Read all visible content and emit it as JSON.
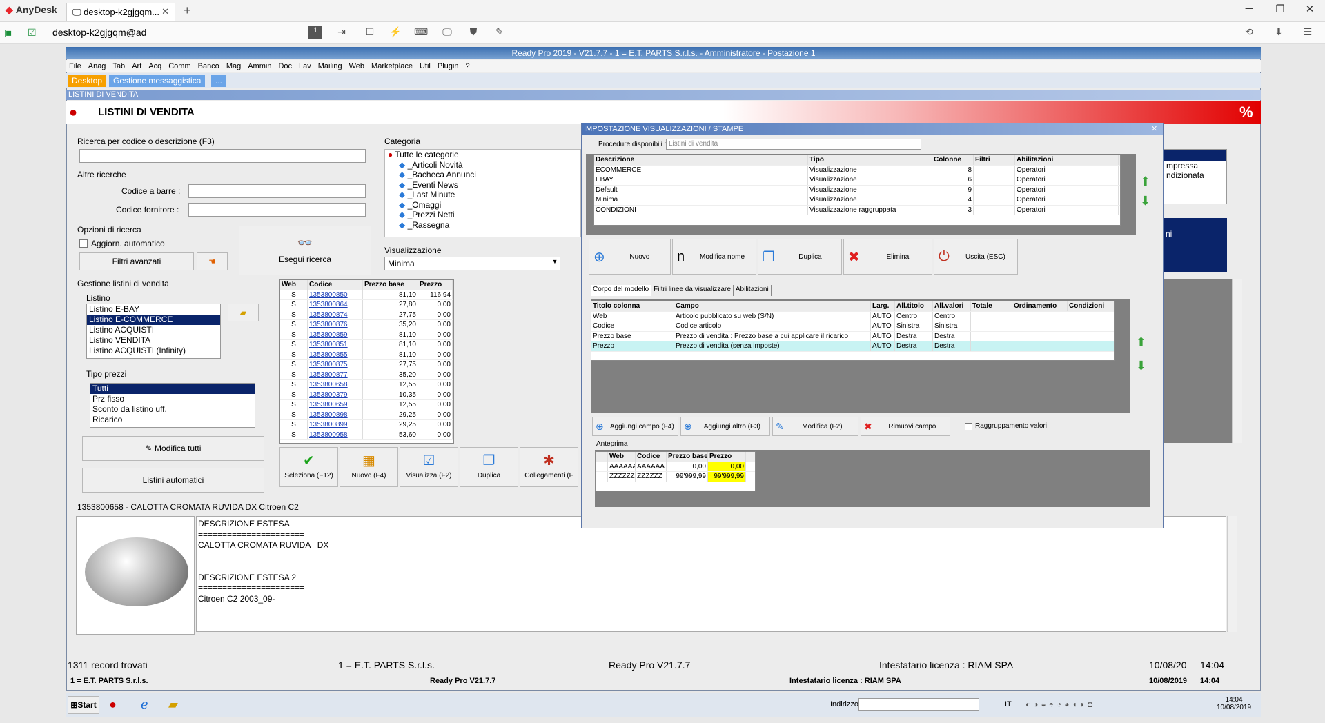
{
  "anydesk": {
    "app": "AnyDesk",
    "tab": "desktop-k2gjgqm...",
    "address": "desktop-k2gjgqm@ad"
  },
  "app": {
    "title": "Ready Pro 2019 - V21.7.7 - 1 = E.T. PARTS S.r.l.s. - Amministratore - Postazione 1",
    "menu": [
      "File",
      "Anag",
      "Tab",
      "Art",
      "Acq",
      "Comm",
      "Banco",
      "Mag",
      "Ammin",
      "Doc",
      "Lav",
      "Mailing",
      "Web",
      "Marketplace",
      "Util",
      "Plugin",
      "?"
    ],
    "tabs": [
      "Desktop",
      "Gestione messaggistica",
      "..."
    ],
    "subtitle": "LISTINI DI VENDITA",
    "header": "LISTINI DI VENDITA"
  },
  "search": {
    "label": "Ricerca per codice o descrizione (F3)",
    "other": "Altre ricerche",
    "barcode": "Codice a barre :",
    "supplier": "Codice fornitore :",
    "options": "Opzioni di ricerca",
    "auto": "Aggiorn. automatico",
    "advanced": "Filtri avanzati",
    "run": "Esegui ricerca"
  },
  "category": {
    "label": "Categoria",
    "items": [
      "Tutte le categorie",
      "_Articoli Novità",
      "_Bacheca Annunci",
      "_Eventi News",
      "_Last Minute",
      "_Omaggi",
      "_Prezzi Netti",
      "_Rassegna"
    ]
  },
  "view": {
    "label": "Visualizzazione",
    "value": "Minima"
  },
  "lists": {
    "label": "Gestione listini di vendita",
    "listino": "Listino",
    "items": [
      "Listino E-BAY",
      "Listino E-COMMERCE",
      "Listino ACQUISTI",
      "Listino VENDITA",
      "Listino ACQUISTI (Infinity)"
    ],
    "pricetype": "Tipo prezzi",
    "prices": [
      "Tutti",
      "Prz fisso",
      "Sconto da listino uff.",
      "Ricarico"
    ],
    "modify_all": "Modifica tutti",
    "auto_lists": "Listini automatici"
  },
  "grid": {
    "headers": [
      "Web",
      "Codice",
      "Prezzo base",
      "Prezzo"
    ],
    "rows": [
      [
        "S",
        "1353800850",
        "81,10",
        "116,94"
      ],
      [
        "S",
        "1353800864",
        "27,80",
        "0,00"
      ],
      [
        "S",
        "1353800874",
        "27,75",
        "0,00"
      ],
      [
        "S",
        "1353800876",
        "35,20",
        "0,00"
      ],
      [
        "S",
        "1353800859",
        "81,10",
        "0,00"
      ],
      [
        "S",
        "1353800851",
        "81,10",
        "0,00"
      ],
      [
        "S",
        "1353800855",
        "81,10",
        "0,00"
      ],
      [
        "S",
        "1353800875",
        "27,75",
        "0,00"
      ],
      [
        "S",
        "1353800877",
        "35,20",
        "0,00"
      ],
      [
        "S",
        "1353800658",
        "12,55",
        "0,00"
      ],
      [
        "S",
        "1353800379",
        "10,35",
        "0,00"
      ],
      [
        "S",
        "1353800659",
        "12,55",
        "0,00"
      ],
      [
        "S",
        "1353800898",
        "29,25",
        "0,00"
      ],
      [
        "S",
        "1353800899",
        "29,25",
        "0,00"
      ],
      [
        "S",
        "1353800958",
        "53,60",
        "0,00"
      ]
    ]
  },
  "actions": [
    "Seleziona (F12)",
    "Nuovo (F4)",
    "Visualizza (F2)",
    "Duplica",
    "Collegamenti (F"
  ],
  "detail": {
    "title": "1353800658 - CALOTTA CROMATA RUVIDA DX Citroen C2",
    "lines": [
      "DESCRIZIONE ESTESA",
      "======================",
      "CALOTTA CROMATA RUVIDA   DX",
      "",
      "",
      "DESCRIZIONE ESTESA 2",
      "======================",
      "Citroen C2 2003_09-"
    ]
  },
  "dialog": {
    "title": "IMPOSTAZIONE VISUALIZZAZIONI / STAMPE",
    "proc_label": "Procedure disponibili :",
    "proc_value": "Listini di vendita",
    "headers": [
      "Descrizione",
      "Tipo",
      "Colonne",
      "Filtri",
      "Abilitazioni"
    ],
    "rows": [
      [
        "ECOMMERCE",
        "Visualizzazione",
        "8",
        "",
        "Operatori"
      ],
      [
        "EBAY",
        "Visualizzazione",
        "6",
        "",
        "Operatori"
      ],
      [
        "Default",
        "Visualizzazione",
        "9",
        "",
        "Operatori"
      ],
      [
        "Minima",
        "Visualizzazione",
        "4",
        "",
        "Operatori"
      ],
      [
        "CONDIZIONI",
        "Visualizzazione raggruppata",
        "3",
        "",
        "Operatori"
      ]
    ],
    "buttons": [
      "Nuovo",
      "Modifica nome",
      "Duplica",
      "Elimina",
      "Uscita (ESC)"
    ],
    "tabs": [
      "Corpo del modello",
      "Filtri linee da visualizzare",
      "Abilitazioni"
    ],
    "fheaders": [
      "Titolo colonna",
      "Campo",
      "Larg.",
      "All.titolo",
      "All.valori",
      "Totale",
      "Ordinamento",
      "Condizioni"
    ],
    "frows": [
      [
        "Web",
        "Articolo pubblicato su web (S/N)",
        "AUTO",
        "Centro",
        "Centro"
      ],
      [
        "Codice",
        "Codice articolo",
        "AUTO",
        "Sinistra",
        "Sinistra"
      ],
      [
        "Prezzo base",
        "Prezzo di vendita : Prezzo base a cui applicare il ricarico",
        "AUTO",
        "Destra",
        "Destra"
      ],
      [
        "Prezzo",
        "Prezzo di vendita (senza imposte)",
        "AUTO",
        "Destra",
        "Destra"
      ]
    ],
    "fbuttons": [
      "Aggiungi campo (F4)",
      "Aggiungi altro (F3)",
      "Modifica (F2)",
      "Rimuovi campo"
    ],
    "group": "Raggruppamento valori",
    "preview": "Anteprima",
    "pheaders": [
      "Web",
      "Codice",
      "Prezzo base",
      "Prezzo"
    ],
    "prows": [
      [
        "AAAAAA",
        "AAAAAA",
        "0,00",
        "0,00"
      ],
      [
        "ZZZZZZ",
        "ZZZZZZ",
        "99'999,99",
        "99'999,99"
      ]
    ]
  },
  "rightpanel": [
    "mpressa",
    "ndizionata",
    "ni"
  ],
  "status": {
    "records": "1311 record trovati",
    "company": "1 = E.T. PARTS S.r.l.s.",
    "version": "Ready Pro V21.7.7",
    "license": "Intestatario licenza : RIAM SPA",
    "date": "10/08/20",
    "time": "14:04",
    "company2": "1 = E.T. PARTS S.r.l.s.",
    "version2": "Ready Pro V21.7.7",
    "license2": "Intestatario licenza : RIAM SPA",
    "date2": "10/08/2019",
    "time2": "14:04"
  },
  "taskbar": {
    "start": "Start",
    "address": "Indirizzo",
    "lang": "IT",
    "time": "14:04",
    "date": "10/08/2019"
  }
}
